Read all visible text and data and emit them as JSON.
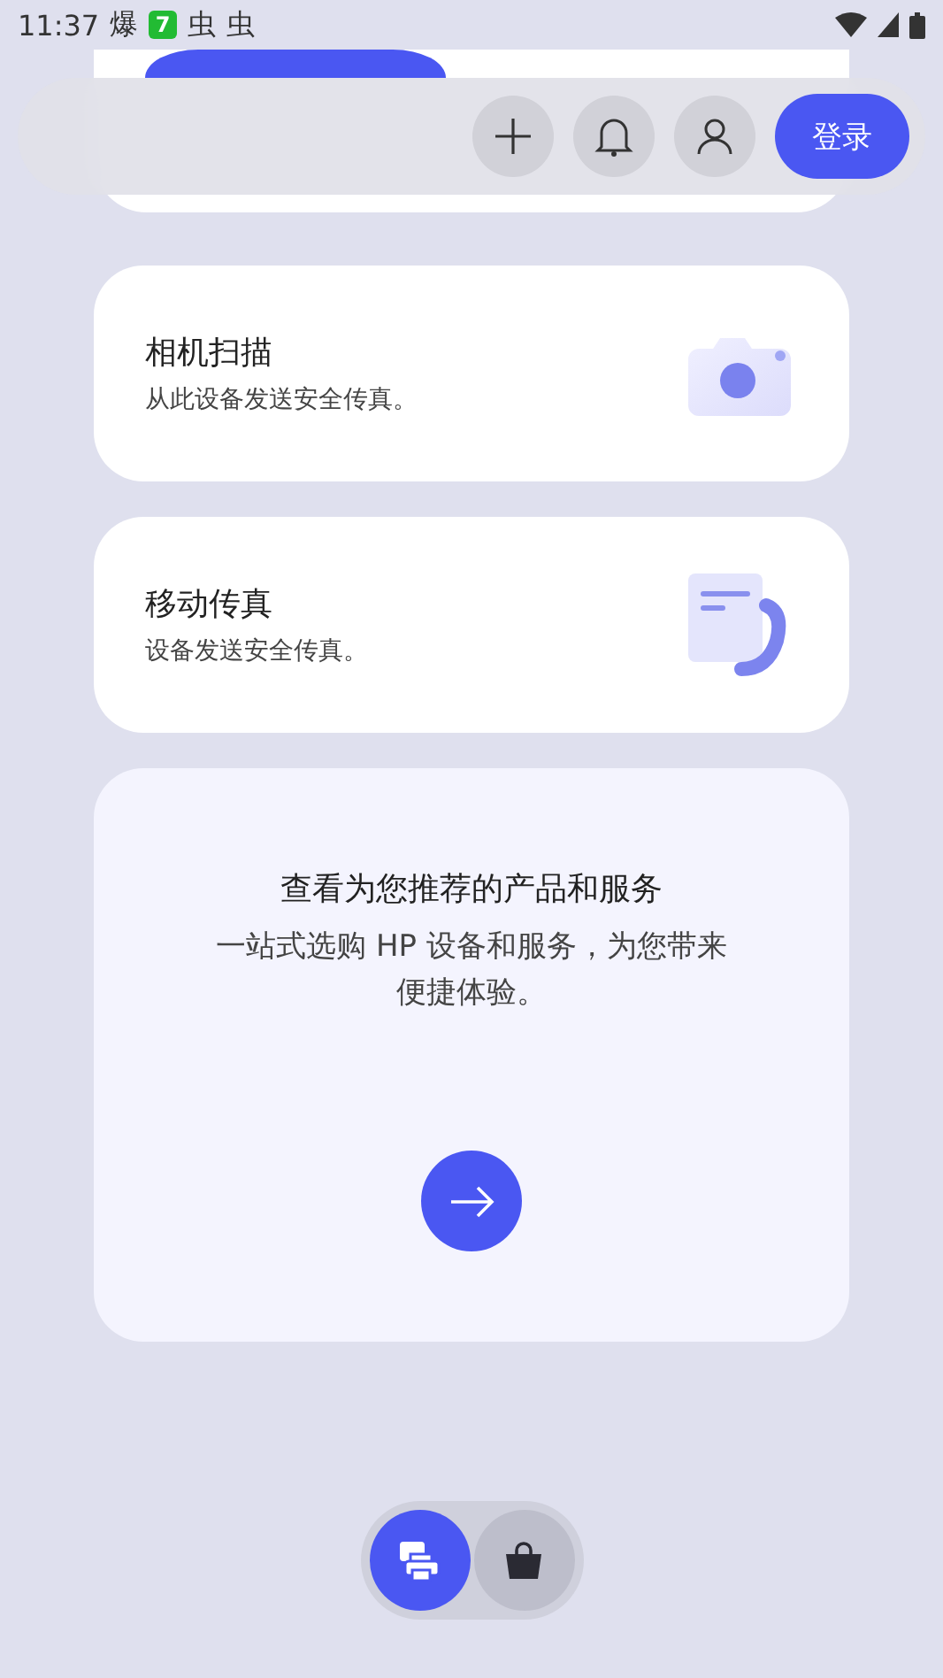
{
  "status_bar": {
    "time": "11:37",
    "notifications": [
      "爆",
      "7",
      "虫",
      "虫"
    ]
  },
  "top_bar": {
    "login_button": "登录"
  },
  "cards": [
    {
      "kind": "camera",
      "title": "相机扫描",
      "subtitle": "从此设备发送安全传真。"
    },
    {
      "kind": "fax",
      "title": "移动传真",
      "subtitle": "设备发送安全传真。"
    }
  ],
  "promo": {
    "title": "查看为您推荐的产品和服务",
    "body": "一站式选购 HP 设备和服务，为您带来便捷体验。"
  },
  "bottom_nav": [
    {
      "kind": "printer",
      "selected": true
    },
    {
      "kind": "shop",
      "selected": false
    }
  ]
}
